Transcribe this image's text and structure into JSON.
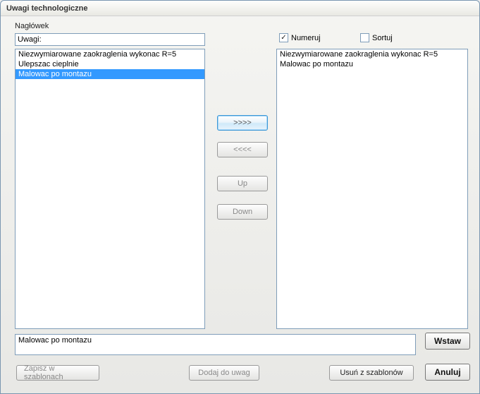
{
  "window_title": "Uwagi technologiczne",
  "header": {
    "label": "Nagłówek",
    "value": "Uwagi:"
  },
  "checkboxes": {
    "numbering": {
      "label": "Numeruj",
      "checked": true
    },
    "sort": {
      "label": "Sortuj",
      "checked": false
    }
  },
  "left_list": {
    "items": [
      {
        "text": "Niezwymiarowane zaokraglenia wykonac R=5",
        "selected": false
      },
      {
        "text": "Ulepszac cieplnie",
        "selected": false
      },
      {
        "text": "Malowac po montazu",
        "selected": true
      }
    ]
  },
  "right_list": {
    "items": [
      {
        "text": "Niezwymiarowane zaokraglenia wykonac R=5"
      },
      {
        "text": "Malowac po montazu"
      }
    ]
  },
  "mid_buttons": {
    "move_right": ">>>>",
    "move_left": "<<<<",
    "up": "Up",
    "down": "Down"
  },
  "edit_value": "Malowac po montazu",
  "bottom_buttons": {
    "save_templates": "Zapisz w szablonach",
    "add_to_notes": "Dodaj do uwag",
    "remove_templates": "Usuń z szablonów"
  },
  "main_buttons": {
    "insert": "Wstaw",
    "cancel": "Anuluj"
  }
}
